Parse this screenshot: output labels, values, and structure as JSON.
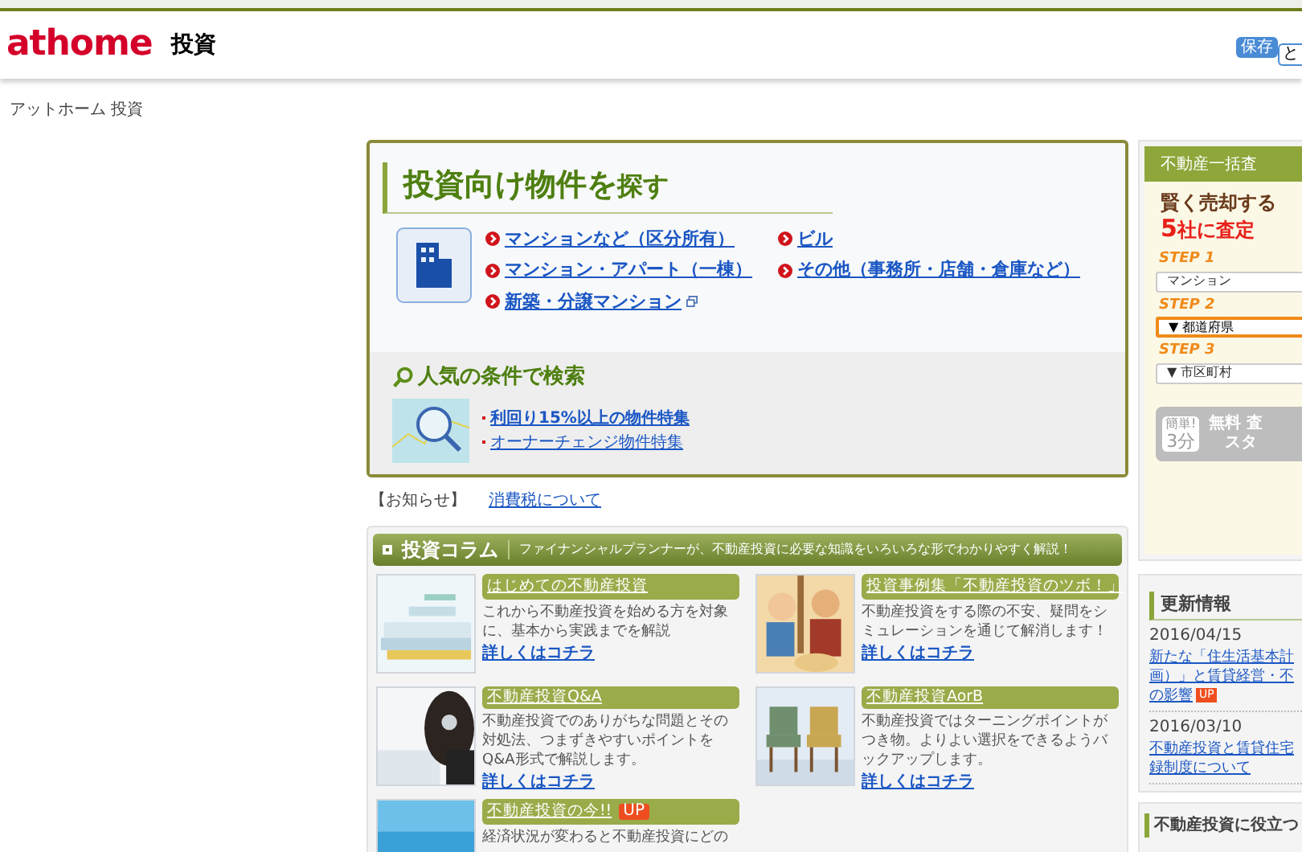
{
  "header": {
    "logo_left": "at",
    "logo_right": "home",
    "section": "投資",
    "save_badge": "保存",
    "save_text": "と"
  },
  "breadcrumb": "アットホーム 投資",
  "search": {
    "title_main": "投資向け物件を",
    "title_tail": "探す",
    "links": [
      {
        "label": "マンションなど（区分所有）",
        "new_window": false
      },
      {
        "label": "ビル",
        "new_window": false
      },
      {
        "label": "マンション・アパート（一棟）",
        "new_window": false
      },
      {
        "label": "その他（事務所・店舗・倉庫など）",
        "new_window": false
      },
      {
        "label": "新築・分譲マンション",
        "new_window": true
      }
    ],
    "popular_title": "人気の条件で検索",
    "popular_links": [
      "利回り15%以上の物件特集",
      "オーナーチェンジ物件特集"
    ]
  },
  "notice": {
    "label": "【お知らせ】",
    "link": "消費税について"
  },
  "column": {
    "title": "投資コラム",
    "subtitle": "ファイナンシャルプランナーが、不動産投資に必要な知識をいろいろな形でわかりやすく解説！",
    "cards": [
      {
        "title": "はじめての不動産投資",
        "text": "これから不動産投資を始める方を対象に、基本から実践までを解説",
        "link": "詳しくはコチラ"
      },
      {
        "title": "投資事例集「不動産投資のツボ！」",
        "text": "不動産投資をする際の不安、疑問をシミュレーションを通じて解消します！",
        "link": "詳しくはコチラ"
      },
      {
        "title": "不動産投資Q&A",
        "text": "不動産投資でのありがちな問題とその対処法、つまずきやすいポイントをQ&A形式で解説します。",
        "link": "詳しくはコチラ"
      },
      {
        "title": "不動産投資AorB",
        "text": "不動産投資ではターニングポイントがつき物。よりよい選択をできるようバックアップします。",
        "link": "詳しくはコチラ"
      },
      {
        "title": "不動産投資の今!!",
        "badge": "UP",
        "text": "経済状況が変わると不動産投資にどの"
      }
    ]
  },
  "assessment": {
    "title": "不動産一括査",
    "lead1": "賢く売却する",
    "lead2_num": "5",
    "lead2": "社に査定",
    "steps": [
      {
        "label": "STEP 1",
        "value": "マンション",
        "selected": false
      },
      {
        "label": "STEP 2",
        "value": "▼ 都道府県",
        "selected": true
      },
      {
        "label": "STEP 3",
        "value": "▼ 市区町村",
        "selected": false
      }
    ],
    "cta_badge1": "簡単!",
    "cta_badge2": "3分",
    "cta_line1": "無料 査",
    "cta_line2": "スタ"
  },
  "updates": {
    "title": "更新情報",
    "items": [
      {
        "date": "2016/04/15",
        "lines": [
          "新たな「住生活基本計",
          "画）」と賃貸経営・不",
          "の影響"
        ],
        "badge": "UP"
      },
      {
        "date": "2016/03/10",
        "lines": [
          "不動産投資と賃貸住宅",
          "録制度について"
        ]
      }
    ]
  },
  "useful": {
    "title": "不動産投資に役立つ"
  }
}
